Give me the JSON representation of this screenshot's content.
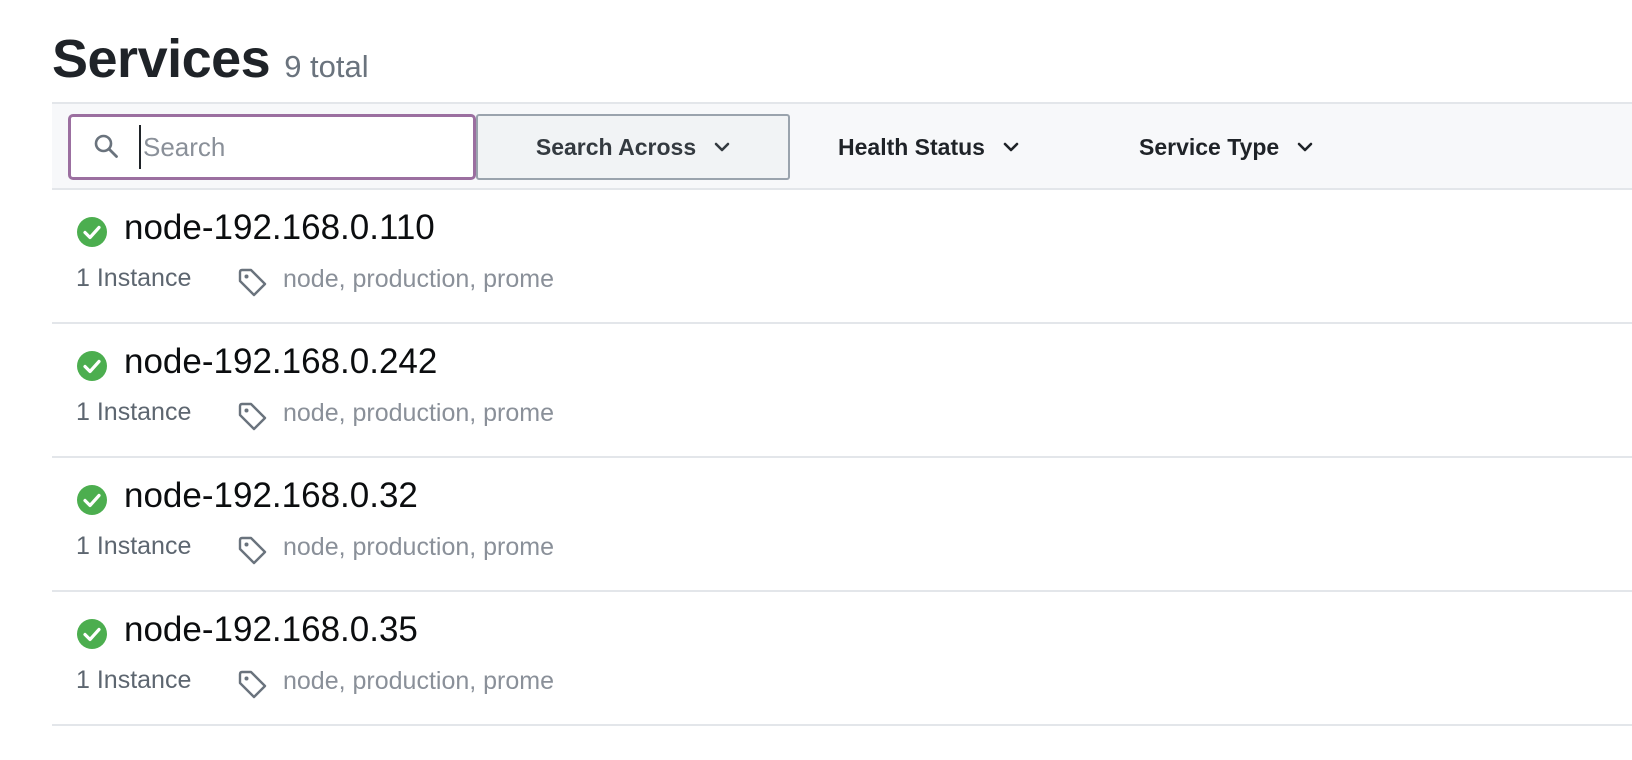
{
  "header": {
    "title": "Services",
    "count": "9 total"
  },
  "toolbar": {
    "search": {
      "placeholder": "Search",
      "value": ""
    },
    "search_across_label": "Search Across",
    "health_status_label": "Health Status",
    "service_type_label": "Service Type"
  },
  "services": [
    {
      "name": "node-192.168.0.110",
      "instances": "1 Instance",
      "tags": "node, production, prome",
      "status": "passing"
    },
    {
      "name": "node-192.168.0.242",
      "instances": "1 Instance",
      "tags": "node, production, prome",
      "status": "passing"
    },
    {
      "name": "node-192.168.0.32",
      "instances": "1 Instance",
      "tags": "node, production, prome",
      "status": "passing"
    },
    {
      "name": "node-192.168.0.35",
      "instances": "1 Instance",
      "tags": "node, production, prome",
      "status": "passing"
    }
  ],
  "colors": {
    "passing": "#4cae4f",
    "search_focus_border": "#9b6fa0"
  },
  "icons": {
    "search": "search-icon",
    "chevron": "chevron-down-icon",
    "status": "check-circle-icon",
    "tag": "tag-icon"
  }
}
